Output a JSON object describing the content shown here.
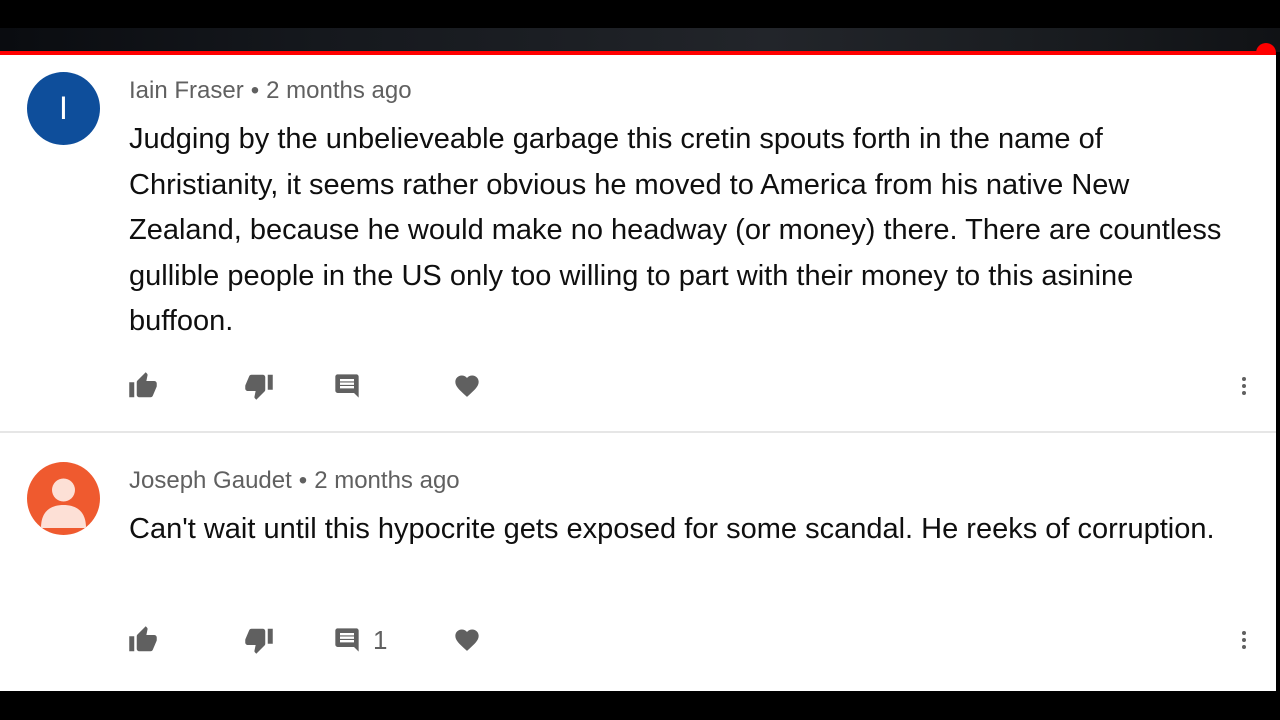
{
  "video": {
    "progress": 0.99,
    "progress_color": "#ff0000"
  },
  "comments": [
    {
      "author": "Iain Fraser",
      "separator": "•",
      "time": "2 months ago",
      "avatar_letter": "I",
      "avatar_color": "#0e4e9b",
      "text": "Judging by the unbelieveable garbage this cretin spouts forth in the name of Christianity, it seems rather obvious he moved to America from his native New Zealand, because he would make no headway (or money) there.  There are countless gullible people in the US only too willing to part with their money to this asinine buffoon.",
      "reply_count": "",
      "icons": [
        "thumb-up-icon",
        "thumb-down-icon",
        "reply-icon",
        "heart-icon",
        "more-vert-icon"
      ]
    },
    {
      "author": "Joseph Gaudet",
      "separator": "•",
      "time": "2 months ago",
      "avatar_icon": "person-icon",
      "avatar_color": "#ef5a2f",
      "text": "Can't wait until this hypocrite gets exposed for some scandal. He reeks of corruption.",
      "reply_count": "1",
      "icons": [
        "thumb-up-icon",
        "thumb-down-icon",
        "reply-icon",
        "heart-icon",
        "more-vert-icon"
      ]
    }
  ]
}
